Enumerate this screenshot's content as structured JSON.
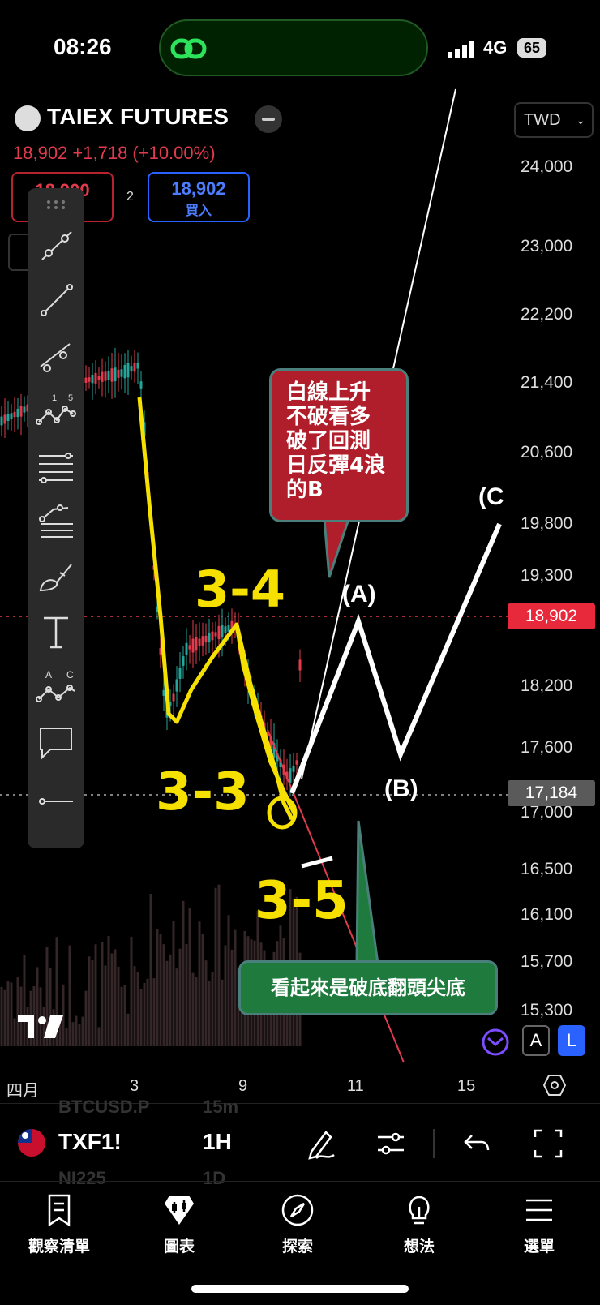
{
  "status_bar": {
    "time": "08:26",
    "network": "4G",
    "battery": "65"
  },
  "header": {
    "symbol_name": "TAIEX FUTURES",
    "price_line": "18,902 +1,718 (+10.00%)",
    "sell_price": "18,900",
    "spread": "2",
    "buy_price": "18,902",
    "buy_label": "買入",
    "currency": "TWD"
  },
  "price_axis": {
    "ticks": [
      "24,000",
      "23,000",
      "22,200",
      "21,400",
      "20,600",
      "19,800",
      "19,300",
      "18,200",
      "17,600",
      "17,000",
      "16,500",
      "16,100",
      "15,700",
      "15,300"
    ],
    "last_price_tag": "18,902",
    "marker_tag": "17,184"
  },
  "time_axis": {
    "labels": [
      "四月",
      "3",
      "9",
      "11",
      "15"
    ]
  },
  "annotations": {
    "wave_labels": [
      "3-4",
      "3-3",
      "3-5"
    ],
    "abc_labels": [
      "(A)",
      "(B)",
      "(C"
    ],
    "red_bubble": "白線上升\n不破看多\n破了回測\n日反彈4浪\n的B",
    "green_bubble": "看起來是破底翻頭尖底"
  },
  "chart_controls": {
    "auto": "A",
    "log": "L"
  },
  "symbol_bar": {
    "symbol": "TXF1!",
    "interval": "1H",
    "ghost_rows": [
      "BTCUSD.P",
      "15m",
      "NI225",
      "1D"
    ]
  },
  "nav": [
    {
      "label": "觀察清單",
      "icon": "watchlist-icon"
    },
    {
      "label": "圖表",
      "icon": "chart-icon"
    },
    {
      "label": "探索",
      "icon": "compass-icon"
    },
    {
      "label": "想法",
      "icon": "lightbulb-icon"
    },
    {
      "label": "選單",
      "icon": "menu-icon"
    }
  ],
  "colors": {
    "down": "#e23b4d",
    "up": "#26a69a",
    "accent": "#2962ff",
    "annotation_yellow": "#f5e000"
  }
}
